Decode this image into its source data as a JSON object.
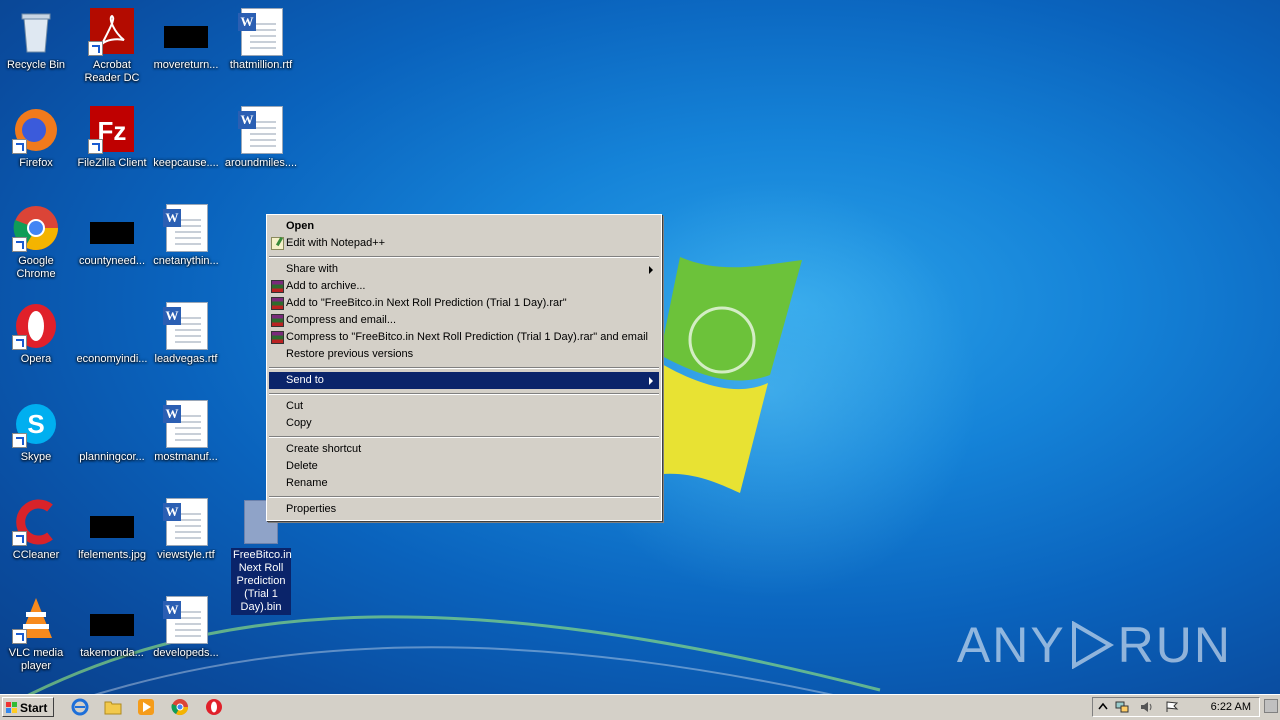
{
  "desktop": {
    "icons": [
      {
        "label": "Recycle Bin"
      },
      {
        "label": "Acrobat Reader DC"
      },
      {
        "label": "movereturn..."
      },
      {
        "label": "thatmillion.rtf"
      },
      {
        "label": "Firefox"
      },
      {
        "label": "FileZilla Client"
      },
      {
        "label": "keepcause...."
      },
      {
        "label": "aroundmiles...."
      },
      {
        "label": "Google Chrome"
      },
      {
        "label": "countyneed..."
      },
      {
        "label": "cnetanythin..."
      },
      {
        "label": "Opera"
      },
      {
        "label": "economyindi..."
      },
      {
        "label": "leadvegas.rtf"
      },
      {
        "label": "Skype"
      },
      {
        "label": "planningcor..."
      },
      {
        "label": "mostmanuf..."
      },
      {
        "label": "CCleaner"
      },
      {
        "label": "lfelements.jpg"
      },
      {
        "label": "viewstyle.rtf"
      },
      {
        "label": "VLC media player"
      },
      {
        "label": "takemonda..."
      },
      {
        "label": "developeds..."
      }
    ],
    "selected_file": {
      "label": "FreeBitco.in Next Roll Prediction (Trial 1 Day).bin"
    }
  },
  "context_menu": {
    "items": [
      {
        "label": "Open"
      },
      {
        "label": "Edit with Notepad++"
      },
      {
        "label": "Share with"
      },
      {
        "label": "Add to archive..."
      },
      {
        "label": "Add to \"FreeBitco.in Next Roll Prediction (Trial 1 Day).rar\""
      },
      {
        "label": "Compress and email..."
      },
      {
        "label": "Compress to \"FreeBitco.in Next Roll Prediction (Trial 1 Day).rar\" and email"
      },
      {
        "label": "Restore previous versions"
      },
      {
        "label": "Send to"
      },
      {
        "label": "Cut"
      },
      {
        "label": "Copy"
      },
      {
        "label": "Create shortcut"
      },
      {
        "label": "Delete"
      },
      {
        "label": "Rename"
      },
      {
        "label": "Properties"
      }
    ]
  },
  "taskbar": {
    "start_label": "Start",
    "clock": "6:22 AM"
  },
  "watermark": {
    "text_left": "ANY",
    "text_right": "RUN"
  },
  "colors": {
    "menu_highlight": "#0a246a",
    "menu_bg": "#d4d0c8",
    "desktop": "#1583d8"
  }
}
